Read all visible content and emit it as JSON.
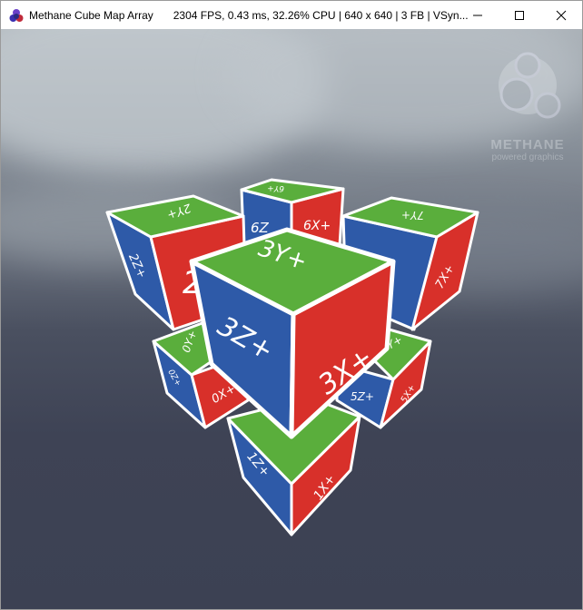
{
  "window": {
    "title": "Methane Cube Map Array",
    "stats": "2304 FPS, 0.43 ms, 32.26% CPU | 640 x 640 | 3 FB | VSyn...",
    "controls": {
      "minimize": "minimize-icon",
      "maximize": "maximize-icon",
      "close": "close-icon"
    }
  },
  "logo": {
    "name": "METHANE",
    "tagline": "powered graphics"
  },
  "colors": {
    "x_face": "#d8302a",
    "y_face": "#5aae3c",
    "z_face": "#2e5aa8",
    "edge": "#ffffff"
  },
  "cubes": {
    "c0": {
      "y": "0Y+",
      "z": "0Z+",
      "x": "0X+"
    },
    "c1": {
      "z": "1Z+",
      "x": "1X+"
    },
    "c2": {
      "y": "2Y+",
      "z": "2Z+",
      "x": "2"
    },
    "c3": {
      "y": "3Y+",
      "z": "3Z+",
      "x": "3X+"
    },
    "c5": {
      "y": "5Y+",
      "z": "5Z+",
      "x": "5X+"
    },
    "c6": {
      "y": "6Y+",
      "z": "6Z",
      "x": "6X+"
    },
    "c7": {
      "y": "7Y+",
      "x": "7X+"
    }
  }
}
